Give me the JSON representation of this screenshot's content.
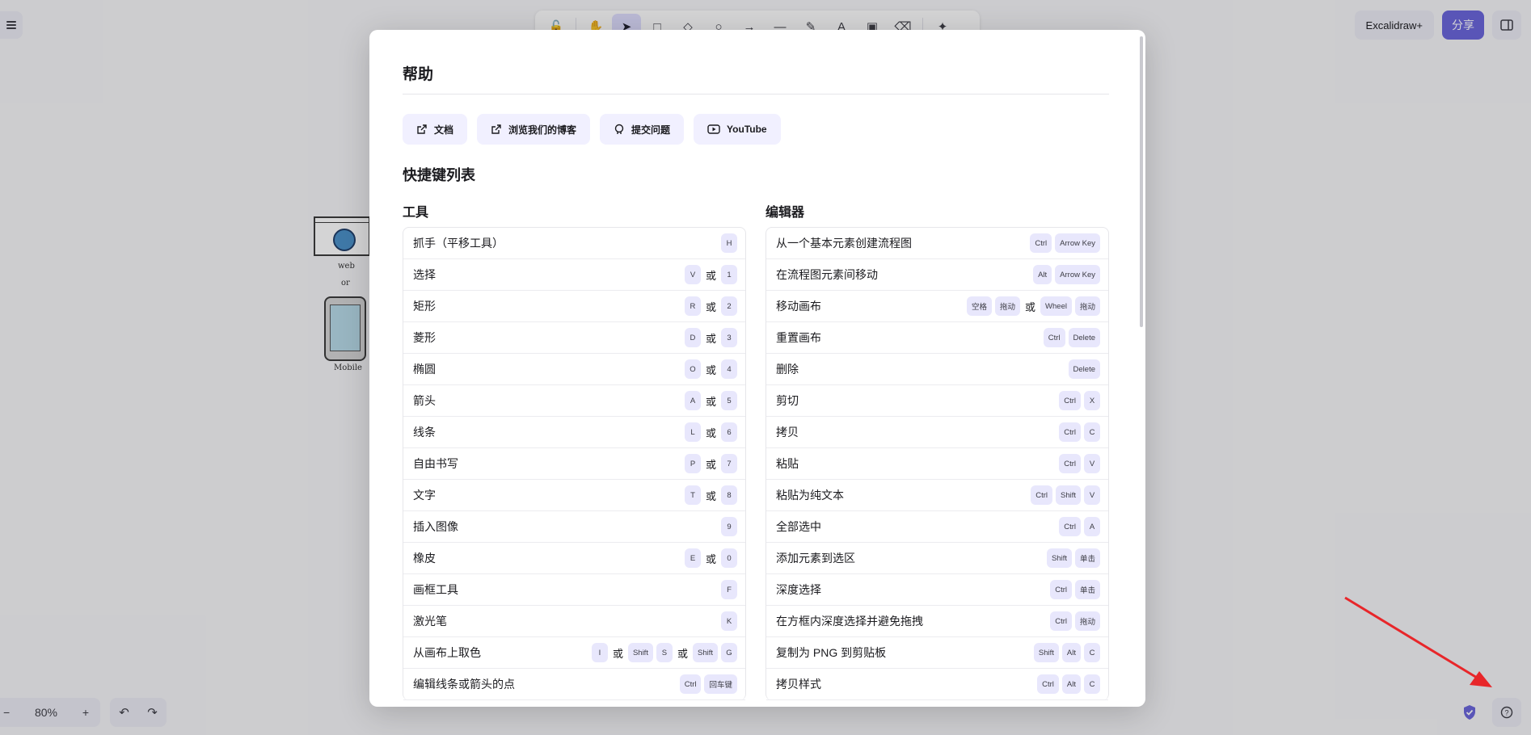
{
  "toolbar": {
    "tools": [
      "lock-icon",
      "hand-icon",
      "pointer-icon",
      "rectangle-icon",
      "diamond-icon",
      "ellipse-icon",
      "arrow-icon",
      "line-icon",
      "pencil-icon",
      "text-icon",
      "image-icon",
      "eraser-icon",
      "shapes-icon"
    ],
    "active_tool": "pointer-icon"
  },
  "header": {
    "plus_label": "Excalidraw+",
    "share_label": "分享"
  },
  "canvas": {
    "web_label": "web",
    "or_label": "or",
    "mobile_label": "Mobile"
  },
  "footer": {
    "zoom": "80%",
    "zoom_out": "−",
    "zoom_in": "+"
  },
  "dialog": {
    "title": "帮助",
    "links": [
      "文档",
      "浏览我们的博客",
      "提交问题",
      "YouTube"
    ],
    "section_title": "快捷键列表",
    "or_text": "或",
    "tools_title": "工具",
    "editor_title": "编辑器",
    "tools": [
      {
        "label": "抓手（平移工具）",
        "keys": [
          [
            "H"
          ]
        ]
      },
      {
        "label": "选择",
        "keys": [
          [
            "V"
          ],
          [
            "1"
          ]
        ]
      },
      {
        "label": "矩形",
        "keys": [
          [
            "R"
          ],
          [
            "2"
          ]
        ]
      },
      {
        "label": "菱形",
        "keys": [
          [
            "D"
          ],
          [
            "3"
          ]
        ]
      },
      {
        "label": "椭圆",
        "keys": [
          [
            "O"
          ],
          [
            "4"
          ]
        ]
      },
      {
        "label": "箭头",
        "keys": [
          [
            "A"
          ],
          [
            "5"
          ]
        ]
      },
      {
        "label": "线条",
        "keys": [
          [
            "L"
          ],
          [
            "6"
          ]
        ]
      },
      {
        "label": "自由书写",
        "keys": [
          [
            "P"
          ],
          [
            "7"
          ]
        ]
      },
      {
        "label": "文字",
        "keys": [
          [
            "T"
          ],
          [
            "8"
          ]
        ]
      },
      {
        "label": "插入图像",
        "keys": [
          [
            "9"
          ]
        ]
      },
      {
        "label": "橡皮",
        "keys": [
          [
            "E"
          ],
          [
            "0"
          ]
        ]
      },
      {
        "label": "画框工具",
        "keys": [
          [
            "F"
          ]
        ]
      },
      {
        "label": "激光笔",
        "keys": [
          [
            "K"
          ]
        ]
      },
      {
        "label": "从画布上取色",
        "keys": [
          [
            "I"
          ],
          [
            "Shift",
            "S"
          ],
          [
            "Shift",
            "G"
          ]
        ]
      },
      {
        "label": "编辑线条或箭头的点",
        "keys": [
          [
            "Ctrl",
            "回车键"
          ]
        ]
      }
    ],
    "editor": [
      {
        "label": "从一个基本元素创建流程图",
        "keys": [
          [
            "Ctrl",
            "Arrow Key"
          ]
        ]
      },
      {
        "label": "在流程图元素间移动",
        "keys": [
          [
            "Alt",
            "Arrow Key"
          ]
        ]
      },
      {
        "label": "移动画布",
        "keys": [
          [
            "空格",
            "拖动"
          ],
          [
            "Wheel",
            "拖动"
          ]
        ]
      },
      {
        "label": "重置画布",
        "keys": [
          [
            "Ctrl",
            "Delete"
          ]
        ]
      },
      {
        "label": "删除",
        "keys": [
          [
            "Delete"
          ]
        ]
      },
      {
        "label": "剪切",
        "keys": [
          [
            "Ctrl",
            "X"
          ]
        ]
      },
      {
        "label": "拷贝",
        "keys": [
          [
            "Ctrl",
            "C"
          ]
        ]
      },
      {
        "label": "粘贴",
        "keys": [
          [
            "Ctrl",
            "V"
          ]
        ]
      },
      {
        "label": "粘贴为纯文本",
        "keys": [
          [
            "Ctrl",
            "Shift",
            "V"
          ]
        ]
      },
      {
        "label": "全部选中",
        "keys": [
          [
            "Ctrl",
            "A"
          ]
        ]
      },
      {
        "label": "添加元素到选区",
        "keys": [
          [
            "Shift",
            "单击"
          ]
        ]
      },
      {
        "label": "深度选择",
        "keys": [
          [
            "Ctrl",
            "单击"
          ]
        ]
      },
      {
        "label": "在方框内深度选择并避免拖拽",
        "keys": [
          [
            "Ctrl",
            "拖动"
          ]
        ]
      },
      {
        "label": "复制为 PNG 到剪贴板",
        "keys": [
          [
            "Shift",
            "Alt",
            "C"
          ]
        ]
      },
      {
        "label": "拷贝样式",
        "keys": [
          [
            "Ctrl",
            "Alt",
            "C"
          ]
        ]
      }
    ]
  },
  "colors": {
    "accent": "#6965db",
    "key_bg": "#e8e7fc",
    "annotation_arrow": "#e8262a"
  }
}
